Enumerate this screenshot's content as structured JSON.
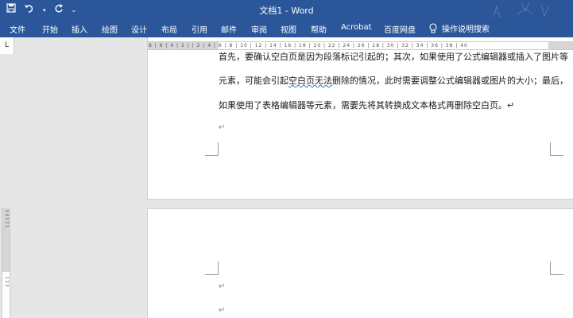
{
  "window": {
    "title": "文档1  -  Word",
    "accent": "#2b579a"
  },
  "qat": {
    "save_icon": "save-icon",
    "undo_icon": "undo-icon",
    "redo_icon": "redo-icon",
    "customize_icon": "customize-qat-icon"
  },
  "ribbon": {
    "tabs": [
      {
        "label": "文件"
      },
      {
        "label": "开始"
      },
      {
        "label": "插入"
      },
      {
        "label": "绘图"
      },
      {
        "label": "设计"
      },
      {
        "label": "布局"
      },
      {
        "label": "引用"
      },
      {
        "label": "邮件"
      },
      {
        "label": "审阅"
      },
      {
        "label": "视图"
      },
      {
        "label": "帮助"
      },
      {
        "label": "Acrobat"
      },
      {
        "label": "百度网盘"
      }
    ],
    "tellme_label": "操作说明搜索"
  },
  "ruler": {
    "corner": "L",
    "hnums": "8 | 6 | 4 | 2 | | 2 | 4 | 6 | 8 | 10 | 12 | 14 | 16 | 18 | 20 | 22 | 24 | 26 | 28 | 30 | 32 | 34 | 36 | 38 | 40",
    "vnums": "5 4 3 2 1",
    "vnums2": "1 2 3"
  },
  "document": {
    "page1": {
      "line1": "首先，要确认空白页是因为段落标记引起的；其次，如果使用了公式编辑器或插入了图片等",
      "line2_before": "元素，可能会引起",
      "line2_squiggle": "空白页无法",
      "line2_after": "删除的情况，此时需要调整公式编辑器或图片的大小；最后，",
      "line3": "如果使用了表格编辑器等元素，需要先将其转换成文本格式再删除空白页。↵",
      "para_mark": "↵"
    },
    "page2": {
      "para_mark_1": "↵",
      "para_mark_2": "↵"
    }
  }
}
